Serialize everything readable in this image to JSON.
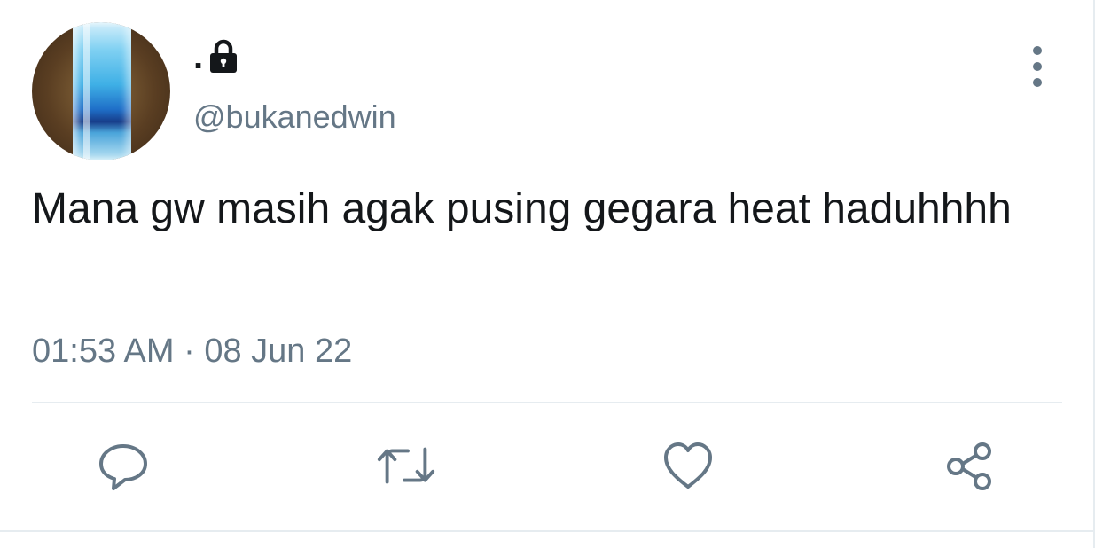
{
  "tweet": {
    "author": {
      "display_name": ".",
      "handle": "@bukanedwin",
      "protected_icon": "lock-icon"
    },
    "text": "Mana gw masih agak pusing gegara heat haduhhhh",
    "time": "01:53 AM",
    "separator": " · ",
    "date": "08 Jun 22",
    "more_icon": "more-vertical-icon"
  },
  "actions": [
    {
      "name": "reply",
      "icon": "reply-icon"
    },
    {
      "name": "retweet",
      "icon": "retweet-icon"
    },
    {
      "name": "like",
      "icon": "heart-icon"
    },
    {
      "name": "share",
      "icon": "share-icon"
    }
  ],
  "colors": {
    "text_primary": "#14171a",
    "text_secondary": "#657786",
    "divider": "#e6ecf0",
    "background": "#ffffff"
  }
}
